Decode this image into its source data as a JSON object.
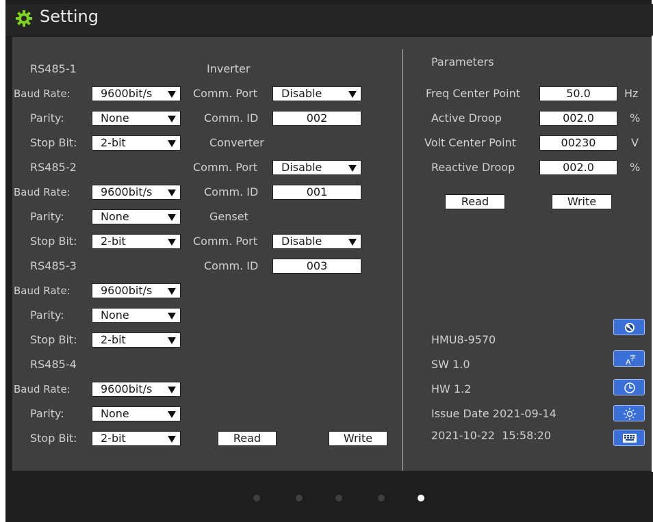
{
  "header": {
    "title": "Setting",
    "icon": "gear-icon"
  },
  "rs485": [
    {
      "title": "RS485-1",
      "baud_label": "Baud Rate:",
      "baud": "9600bit/s",
      "parity_label": "Parity:",
      "parity": "None",
      "stop_label": "Stop Bit:",
      "stop": "2-bit"
    },
    {
      "title": "RS485-2",
      "baud_label": "Baud Rate:",
      "baud": "9600bit/s",
      "parity_label": "Parity:",
      "parity": "None",
      "stop_label": "Stop Bit:",
      "stop": "2-bit"
    },
    {
      "title": "RS485-3",
      "baud_label": "Baud Rate:",
      "baud": "9600bit/s",
      "parity_label": "Parity:",
      "parity": "None",
      "stop_label": "Stop Bit:",
      "stop": "2-bit"
    },
    {
      "title": "RS485-4",
      "baud_label": "Baud Rate:",
      "baud": "9600bit/s",
      "parity_label": "Parity:",
      "parity": "None",
      "stop_label": "Stop Bit:",
      "stop": "2-bit"
    }
  ],
  "devices": [
    {
      "title": "Inverter",
      "port_label": "Comm. Port",
      "port": "Disable",
      "id_label": "Comm. ID",
      "id": "002"
    },
    {
      "title": "Converter",
      "port_label": "Comm. Port",
      "port": "Disable",
      "id_label": "Comm. ID",
      "id": "001"
    },
    {
      "title": "Genset",
      "port_label": "Comm. Port",
      "port": "Disable",
      "id_label": "Comm. ID",
      "id": "003"
    }
  ],
  "left_actions": {
    "read": "Read",
    "write": "Write"
  },
  "parameters": {
    "title": "Parameters",
    "items": [
      {
        "label": "Freq Center Point",
        "value": "50.0",
        "unit": "Hz"
      },
      {
        "label": "Active Droop",
        "value": "002.0",
        "unit": "%"
      },
      {
        "label": "Volt Center Point",
        "value": "00230",
        "unit": "V"
      },
      {
        "label": "Reactive Droop",
        "value": "002.0",
        "unit": "%"
      }
    ],
    "read": "Read",
    "write": "Write"
  },
  "info": {
    "model": "HMU8-9570",
    "sw": "SW 1.0",
    "hw": "HW 1.2",
    "issue_date": "Issue Date 2021-09-14",
    "datetime": "2021-10-22  15:58:20"
  },
  "side_buttons": [
    "wrench-icon",
    "language-icon",
    "clock-icon",
    "brightness-icon",
    "keyboard-icon"
  ],
  "pager": {
    "count": 5,
    "active": 5
  },
  "colors": {
    "panel": "#3f3f3f",
    "background": "#1e1e1e",
    "accent_button": "#3a6fd8",
    "title_icon": "#7ed321"
  }
}
